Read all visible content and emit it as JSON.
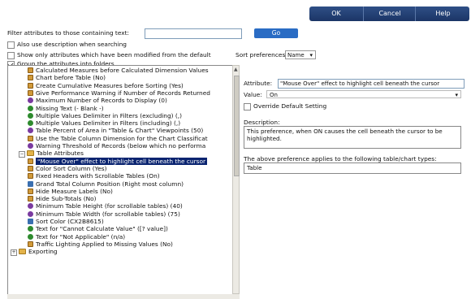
{
  "toolbar": {
    "ok": "OK",
    "cancel": "Cancel",
    "help": "Help"
  },
  "filter": {
    "label": "Filter attributes to those containing text:",
    "value": "",
    "go": "Go"
  },
  "options": {
    "also_description": "Also use description when searching",
    "show_modified": "Show only attributes which have been modified from the default",
    "group_folders": "Group the attributes into folders",
    "sort_label": "Sort preferences by",
    "sort_value": "Name"
  },
  "tree": {
    "rows": [
      {
        "icon": "table",
        "label": "Calculated Measures before Calculated Dimension Values"
      },
      {
        "icon": "table",
        "label": "Chart before Table (No)"
      },
      {
        "icon": "table",
        "label": "Create Cumulative Measures before Sorting (Yes)"
      },
      {
        "icon": "table",
        "label": "Give Performance Warning if Number of Records Returned"
      },
      {
        "icon": "purple",
        "label": "Maximum Number of Records to Display (0)"
      },
      {
        "icon": "green",
        "label": "Missing Text (- Blank -)"
      },
      {
        "icon": "green",
        "label": "Multiple Values Delimiter in Filters (excluding) (,)"
      },
      {
        "icon": "green",
        "label": "Multiple Values Delimiter in Filters (including) (,)"
      },
      {
        "icon": "purple",
        "label": "Table Percent of Area in \"Table & Chart\" Viewpoints (50)"
      },
      {
        "icon": "table",
        "label": "Use the Table Column Dimension for the Chart Classificat"
      },
      {
        "icon": "purple",
        "label": "Warning Threshold of Records (below which no performa"
      }
    ],
    "folder_table": "Table Attributes",
    "table_rows": [
      {
        "icon": "table",
        "label": "\"Mouse Over\" effect to highlight cell beneath the cursor"
      },
      {
        "icon": "table",
        "label": "Color Sort Column (Yes)"
      },
      {
        "icon": "table",
        "label": "Fixed Headers with Scrollable Tables (On)"
      },
      {
        "icon": "blue",
        "label": "Grand Total Column Position (Right most column)"
      },
      {
        "icon": "table",
        "label": "Hide Measure Labels (No)"
      },
      {
        "icon": "table",
        "label": "Hide Sub-Totals (No)"
      },
      {
        "icon": "purple",
        "label": "Minimum Table Height (for scrollable tables) (40)"
      },
      {
        "icon": "purple",
        "label": "Minimum Table Width (for scrollable tables) (75)"
      },
      {
        "icon": "blue",
        "label": "Sort Color (CX2B8615)"
      },
      {
        "icon": "green",
        "label": "Text for \"Cannot Calculate Value\" ([? value])"
      },
      {
        "icon": "green",
        "label": "Text for \"Not Applicable\" (n/a)"
      },
      {
        "icon": "table",
        "label": "Traffic Lighting Applied to Missing Values (No)"
      }
    ],
    "folder_exporting": "Exporting"
  },
  "detail": {
    "attribute_label": "Attribute:",
    "attribute_value": "\"Mouse Over\" effect to highlight cell beneath the cursor",
    "value_label": "Value:",
    "value_value": "On",
    "override": "Override Default Setting",
    "description_label": "Description:",
    "description_text": "This preference, when ON causes the cell beneath the cursor to be highlighted.",
    "applies_label": "The above preference applies to the following table/chart types:",
    "applies_value": "Table"
  },
  "colors": {
    "accent": "#1b3566",
    "go": "#2a6cc4",
    "selection": "#0a2470"
  }
}
